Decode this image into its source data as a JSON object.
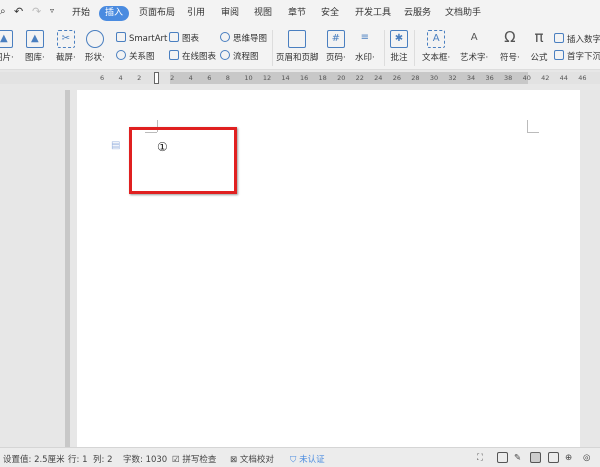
{
  "tabs": [
    "开始",
    "插入",
    "页面布局",
    "引用",
    "审阅",
    "视图",
    "章节",
    "安全",
    "开发工具",
    "云服务",
    "文档助手"
  ],
  "active_tab": "插入",
  "ribbon": {
    "picture": "图片",
    "gallery": "图库",
    "screenshot": "截屏",
    "shape": "形状",
    "smartart": "SmartArt",
    "relation": "关系图",
    "chart": "图表",
    "online_chart": "在线图表",
    "mindmap": "思维导图",
    "flowchart": "流程图",
    "header_footer": "页眉和页脚",
    "page_number": "页码",
    "watermark": "水印",
    "comment": "批注",
    "textbox": "文本框",
    "wordart": "艺术字",
    "symbol": "符号",
    "formula": "公式",
    "insert_number": "插入数字",
    "drop_cap": "首字下沉"
  },
  "ruler_ticks": [
    "6",
    "4",
    "2",
    "2",
    "4",
    "6",
    "8",
    "10",
    "12",
    "14",
    "16",
    "18",
    "20",
    "22",
    "24",
    "26",
    "28",
    "30",
    "32",
    "34",
    "36",
    "38",
    "40",
    "42",
    "44",
    "46"
  ],
  "document": {
    "marker": "①"
  },
  "status": {
    "setting": "设置值: 2.5厘米",
    "row": "行: 1",
    "col": "列: 2",
    "words": "字数: 1030",
    "spell": "拼写检查",
    "proof": "文档校对",
    "cert": "未认证"
  },
  "colors": {
    "accent": "#4a8be0",
    "highlight": "#e02020"
  }
}
